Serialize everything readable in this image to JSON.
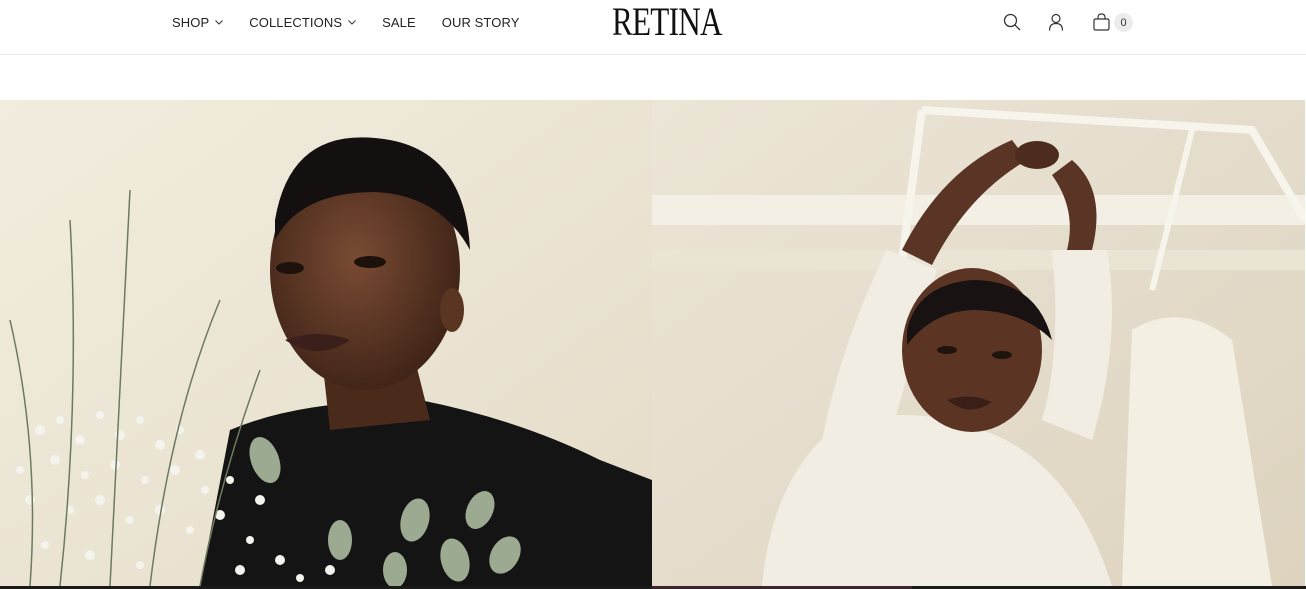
{
  "nav": {
    "items": [
      {
        "label": "SHOP",
        "has_dropdown": true
      },
      {
        "label": "COLLECTIONS",
        "has_dropdown": true
      },
      {
        "label": "SALE",
        "has_dropdown": false
      },
      {
        "label": "OUR STORY",
        "has_dropdown": false
      }
    ]
  },
  "brand": {
    "logo_text": "RETINA"
  },
  "header_icons": {
    "search": "search-icon",
    "account": "account-icon",
    "cart": "cart-icon",
    "cart_count": "0"
  },
  "hero": {
    "left_image": "model-with-flowers",
    "right_image": "model-stretching-arms"
  },
  "colors": {
    "text": "#1a1a1a",
    "divider": "#e6e6e6",
    "badge_bg": "#ececec"
  }
}
